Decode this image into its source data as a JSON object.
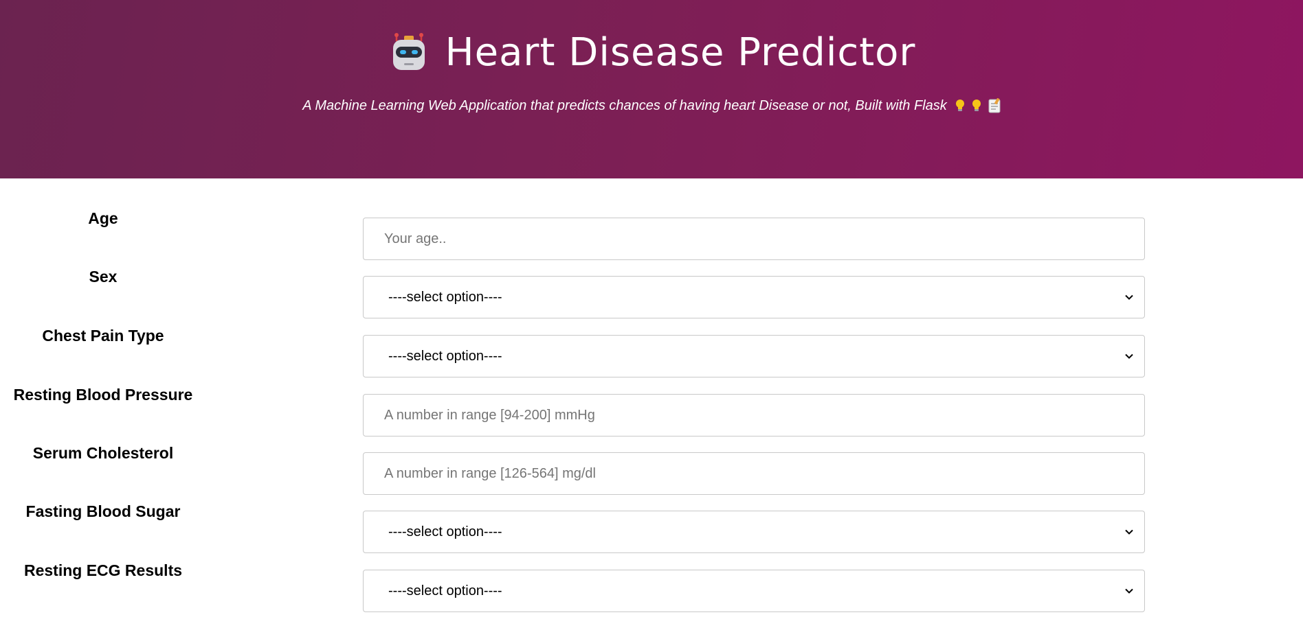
{
  "header": {
    "title": "Heart Disease Predictor",
    "subtitle": "A Machine Learning Web Application that predicts chances of having heart Disease or not, Built with Flask",
    "icon": "robot-icon",
    "subtitle_icons": [
      "lightbulb-icon",
      "lightbulb-icon",
      "memo-icon"
    ],
    "colors": {
      "gradient_start": "#6b2350",
      "gradient_end": "#8e1660",
      "text": "#ffffff"
    }
  },
  "form": {
    "fields": [
      {
        "label": "Age",
        "type": "input",
        "placeholder": "Your age.."
      },
      {
        "label": "Sex",
        "type": "select",
        "value": "----select option----"
      },
      {
        "label": "Chest Pain Type",
        "type": "select",
        "value": "----select option----"
      },
      {
        "label": "Resting Blood Pressure",
        "type": "input",
        "placeholder": "A number in range [94-200] mmHg"
      },
      {
        "label": "Serum Cholesterol",
        "type": "input",
        "placeholder": "A number in range [126-564] mg/dl"
      },
      {
        "label": "Fasting Blood Sugar",
        "type": "select",
        "value": "----select option----"
      },
      {
        "label": "Resting ECG Results",
        "type": "select",
        "value": "----select option----"
      }
    ]
  }
}
